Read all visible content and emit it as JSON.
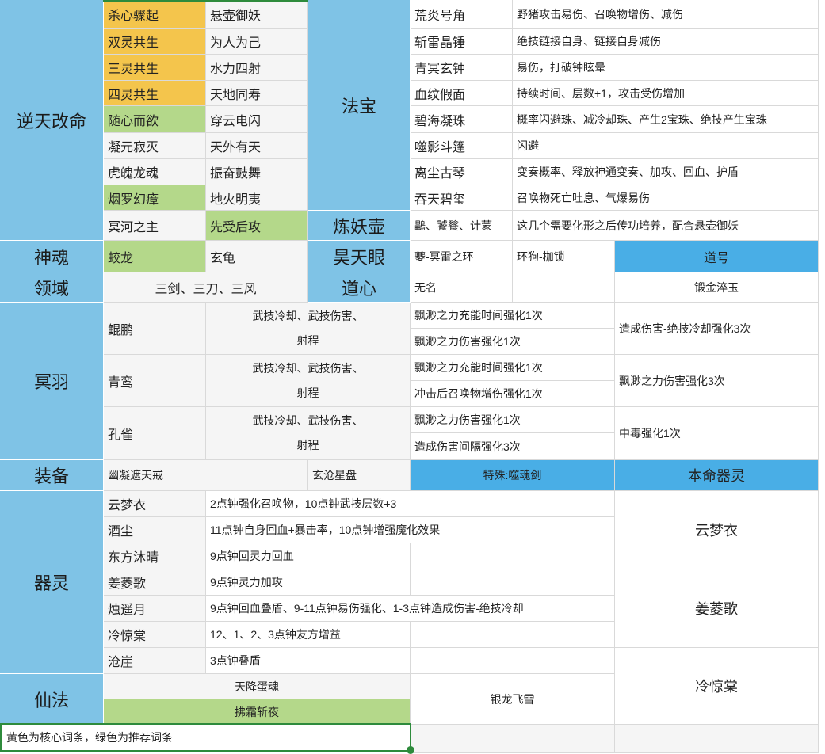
{
  "sections": {
    "nitian": "逆天改命",
    "fabao": "法宝",
    "lianyaohu": "炼妖壶",
    "shenhun": "神魂",
    "haotianyan": "昊天眼",
    "lingyu": "领域",
    "daoxin": "道心",
    "mingyu": "冥羽",
    "zhuangbei": "装备",
    "qiling": "器灵",
    "xianfa": "仙法"
  },
  "nitian_rows": [
    {
      "a": "杀心骤起",
      "b": "悬壶御妖"
    },
    {
      "a": "双灵共生",
      "b": "为人为己"
    },
    {
      "a": "三灵共生",
      "b": "水力四射"
    },
    {
      "a": "四灵共生",
      "b": "天地同寿"
    },
    {
      "a": "随心而欲",
      "b": "穿云电闪"
    },
    {
      "a": "凝元寂灭",
      "b": "天外有天"
    },
    {
      "a": "虎魄龙魂",
      "b": "振奋鼓舞"
    },
    {
      "a": "烟罗幻瘴",
      "b": "地火明夷"
    }
  ],
  "nitian_last": {
    "a": "冥河之主",
    "b": "先受后攻"
  },
  "fabao_rows": [
    {
      "name": "荒炎号角",
      "desc": "野猪攻击易伤、召唤物增伤、减伤"
    },
    {
      "name": "斩雷晶锤",
      "desc": "绝技链接自身、链接自身减伤"
    },
    {
      "name": "青冥玄钟",
      "desc": "易伤，打破钟眩晕"
    },
    {
      "name": "血纹假面",
      "desc": "持续时间、层数+1，攻击受伤增加"
    },
    {
      "name": "碧海凝珠",
      "desc": "概率闪避珠、减冷却珠、产生2宝珠、绝技产生宝珠"
    },
    {
      "name": "噬影斗篷",
      "desc": "闪避"
    },
    {
      "name": "离尘古琴",
      "desc": "变奏概率、释放神通变奏、加攻、回血、护盾"
    },
    {
      "name": "吞天碧玺",
      "desc": "召唤物死亡吐息、气爆易伤"
    }
  ],
  "lianyaohu": {
    "pets": "鸓、饕餮、计蒙",
    "desc": "这几个需要化形之后传功培养，配合悬壶御妖"
  },
  "shenhun": {
    "a": "蛟龙",
    "b": "玄龟"
  },
  "haotianyan": {
    "a": "夔-冥雷之环",
    "b": "环狗-枷锁"
  },
  "daohao": {
    "header": "道号",
    "value": "锻金淬玉"
  },
  "lingyu": {
    "value": "三剑、三刀、三风"
  },
  "daoxin": {
    "value": "无名"
  },
  "mingyu_rows": [
    {
      "name": "鲲鹏",
      "base_line1": "武技冷却、武技伤害、",
      "base_line2": "射程",
      "s1": "飘渺之力充能时间强化1次",
      "s2": "飘渺之力伤害强化1次",
      "extra": "造成伤害-绝技冷却强化3次"
    },
    {
      "name": "青鸾",
      "base_line1": "武技冷却、武技伤害、",
      "base_line2": "射程",
      "s1": "飘渺之力充能时间强化1次",
      "s2": "冲击后召唤物增伤强化1次",
      "extra": "飘渺之力伤害强化3次"
    },
    {
      "name": "孔雀",
      "base_line1": "武技冷却、武技伤害、",
      "base_line2": "射程",
      "s1": "飘渺之力伤害强化1次",
      "s2": "造成伤害间隔强化3次",
      "extra": "中毒强化1次"
    }
  ],
  "zhuangbei": {
    "ring": "幽凝遮天戒",
    "plate": "玄沧星盘",
    "special": "特殊:噬魂剑",
    "benming_header": "本命器灵"
  },
  "qiling_rows": [
    {
      "name": "云梦衣",
      "desc": "2点钟强化召唤物，10点钟武技层数+3"
    },
    {
      "name": "酒尘",
      "desc": "11点钟自身回血+暴击率，10点钟增强魔化效果"
    },
    {
      "name": "东方沐晴",
      "desc": "9点钟回灵力回血"
    },
    {
      "name": "姜菱歌",
      "desc": "9点钟灵力加攻"
    },
    {
      "name": "烛遥月",
      "desc": "9点钟回血叠盾、9-11点钟易伤强化、1-3点钟造成伤害-绝技冷却"
    },
    {
      "name": "冷惊棠",
      "desc": "12、1、2、3点钟友方增益"
    },
    {
      "name": "沧崖",
      "desc": "3点钟叠盾"
    }
  ],
  "benming": [
    "云梦衣",
    "姜菱歌",
    "冷惊棠"
  ],
  "xianfa": {
    "a": "天降蛋魂",
    "b": "拂霜斩夜",
    "c": "银龙飞雪"
  },
  "note": "黄色为核心词条，绿色为推荐词条"
}
